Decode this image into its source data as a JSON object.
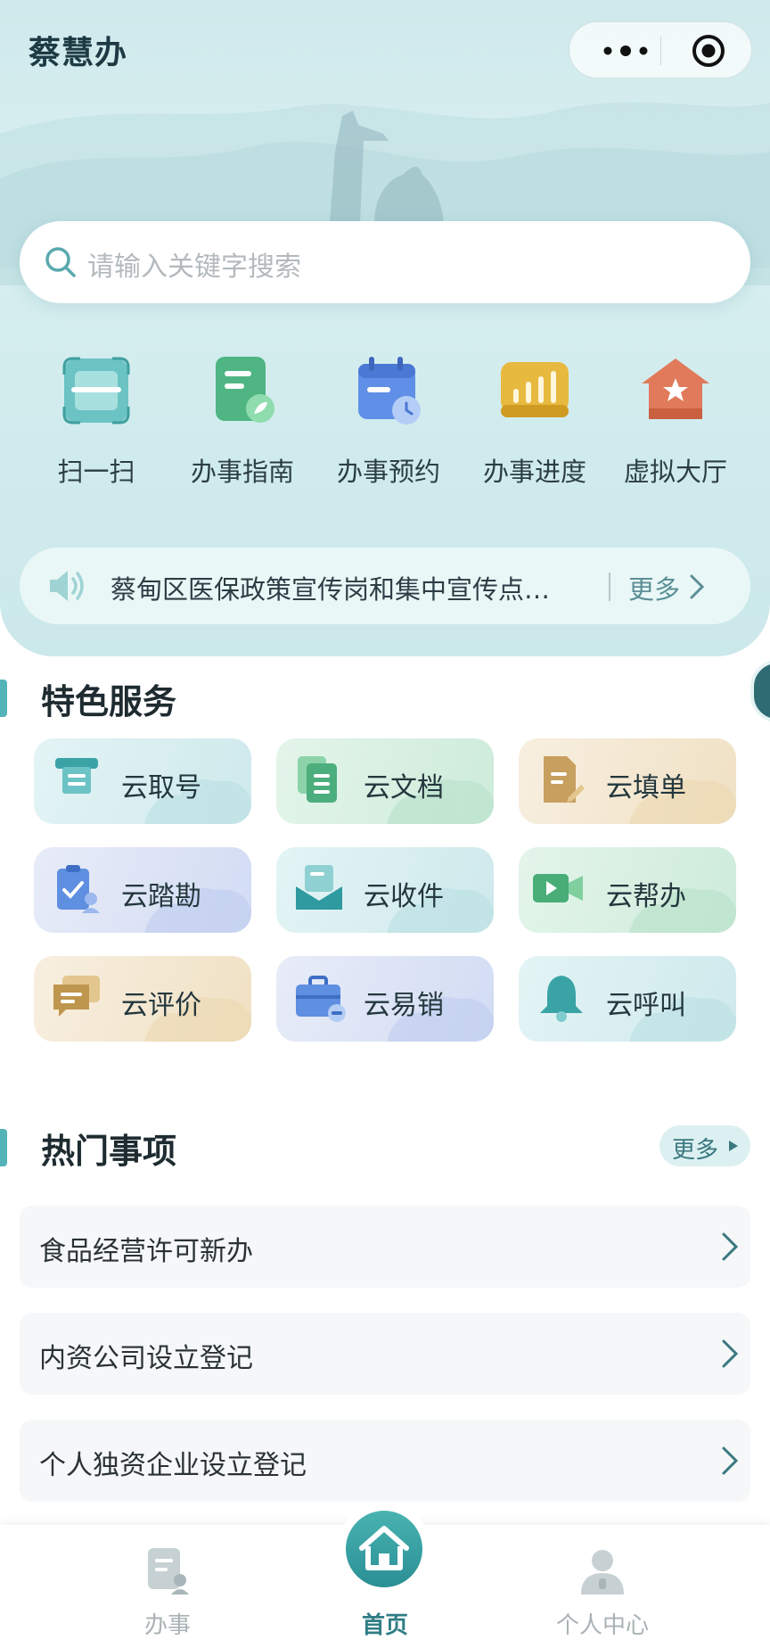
{
  "app": {
    "title": "蔡慧办"
  },
  "capsule": {
    "more_icon": "more-dots-icon",
    "close_icon": "close-ring-icon"
  },
  "search": {
    "placeholder": "请输入关键字搜索"
  },
  "quick_actions": [
    {
      "label": "扫一扫",
      "icon": "scan-icon"
    },
    {
      "label": "办事指南",
      "icon": "guide-icon"
    },
    {
      "label": "办事预约",
      "icon": "calendar-icon"
    },
    {
      "label": "办事进度",
      "icon": "progress-chart-icon"
    },
    {
      "label": "虚拟大厅",
      "icon": "virtual-hall-icon"
    }
  ],
  "notice": {
    "text": "蔡甸区医保政策宣传岗和集中宣传点…",
    "more": "更多"
  },
  "featured": {
    "title": "特色服务",
    "items": [
      {
        "label": "云取号",
        "icon": "ticket-machine-icon"
      },
      {
        "label": "云文档",
        "icon": "document-icon"
      },
      {
        "label": "云填单",
        "icon": "form-edit-icon"
      },
      {
        "label": "云踏勘",
        "icon": "survey-clipboard-icon"
      },
      {
        "label": "云收件",
        "icon": "inbox-icon"
      },
      {
        "label": "云帮办",
        "icon": "video-camera-icon"
      },
      {
        "label": "云评价",
        "icon": "comment-icon"
      },
      {
        "label": "云易销",
        "icon": "briefcase-icon"
      },
      {
        "label": "云呼叫",
        "icon": "bell-icon"
      }
    ]
  },
  "hot": {
    "title": "热门事项",
    "more": "更多",
    "items": [
      {
        "label": "食品经营许可新办"
      },
      {
        "label": "内资公司设立登记"
      },
      {
        "label": "个人独资企业设立登记"
      }
    ]
  },
  "tabbar": {
    "items": [
      {
        "label": "办事",
        "icon": "affairs-icon"
      },
      {
        "label": "首页",
        "icon": "home-icon"
      },
      {
        "label": "个人中心",
        "icon": "user-icon"
      }
    ],
    "active_color": "#2f7d84",
    "inactive_color": "#aab2b5"
  }
}
